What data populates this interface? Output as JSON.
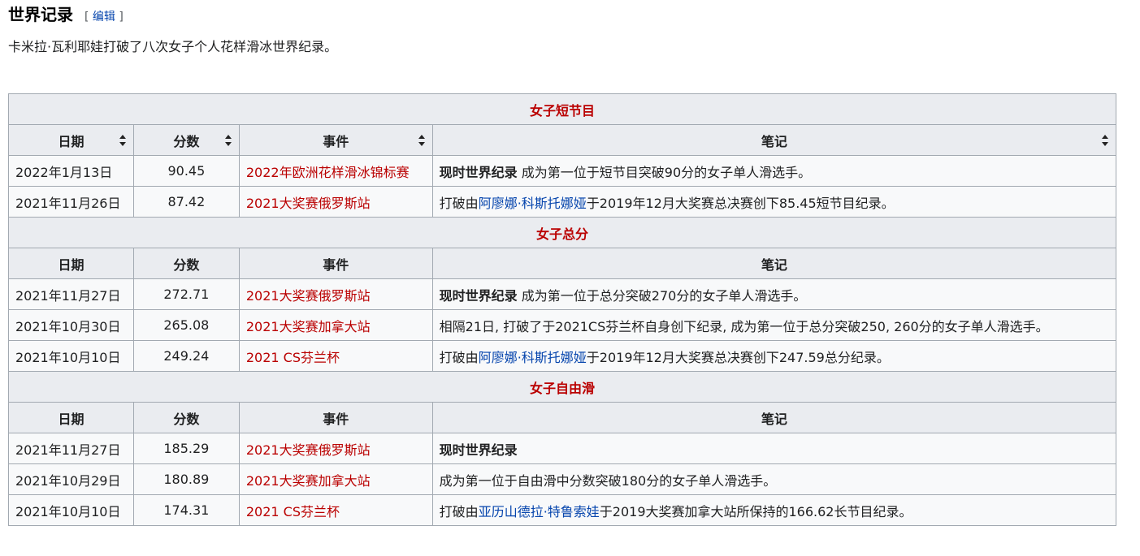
{
  "heading": {
    "title": "世界记录",
    "edit_open": "[",
    "edit_label": "编辑",
    "edit_close": "]"
  },
  "intro": "卡米拉·瓦利耶娃打破了八次女子个人花样滑冰世界纪录。",
  "columns": {
    "date": "日期",
    "score": "分数",
    "event": "事件",
    "note": "笔记"
  },
  "sections": [
    {
      "title": "女子短节目",
      "rows": [
        {
          "date": "2022年1月13日",
          "score": "90.45",
          "event": "2022年欧洲花样滑冰锦标赛",
          "note_bold": "现时世界纪录",
          "note_pre": "",
          "note_link": "",
          "note_post": "成为第一位于短节目突破90分的女子单人滑选手。"
        },
        {
          "date": "2021年11月26日",
          "score": "87.42",
          "event": "2021大奖赛俄罗斯站",
          "note_bold": "",
          "note_pre": "打破由",
          "note_link": "阿廖娜·科斯托娜娅",
          "note_post": "于2019年12月大奖赛总决赛创下85.45短节目纪录。"
        }
      ]
    },
    {
      "title": "女子总分",
      "rows": [
        {
          "date": "2021年11月27日",
          "score": "272.71",
          "event": "2021大奖赛俄罗斯站",
          "note_bold": "现时世界纪录",
          "note_pre": "",
          "note_link": "",
          "note_post": "成为第一位于总分突破270分的女子单人滑选手。"
        },
        {
          "date": "2021年10月30日",
          "score": "265.08",
          "event": "2021大奖赛加拿大站",
          "note_bold": "",
          "note_pre": "相隔21日, 打破了于2021CS芬兰杯自身创下纪录, 成为第一位于总分突破250, 260分的女子单人滑选手。",
          "note_link": "",
          "note_post": ""
        },
        {
          "date": "2021年10月10日",
          "score": "249.24",
          "event": "2021 CS芬兰杯",
          "note_bold": "",
          "note_pre": "打破由",
          "note_link": "阿廖娜·科斯托娜娅",
          "note_post": "于2019年12月大奖赛总决赛创下247.59总分纪录。"
        }
      ]
    },
    {
      "title": "女子自由滑",
      "rows": [
        {
          "date": "2021年11月27日",
          "score": "185.29",
          "event": "2021大奖赛俄罗斯站",
          "note_bold": "现时世界纪录",
          "note_pre": "",
          "note_link": "",
          "note_post": ""
        },
        {
          "date": "2021年10月29日",
          "score": "180.89",
          "event": "2021大奖赛加拿大站",
          "note_bold": "",
          "note_pre": "成为第一位于自由滑中分数突破180分的女子单人滑选手。",
          "note_link": "",
          "note_post": ""
        },
        {
          "date": "2021年10月10日",
          "score": "174.31",
          "event": "2021 CS芬兰杯",
          "note_bold": "",
          "note_pre": "打破由",
          "note_link": "亚历山德拉·特鲁索娃",
          "note_post": "于2019大奖赛加拿大站所保持的166.62长节目纪录。"
        }
      ]
    }
  ]
}
